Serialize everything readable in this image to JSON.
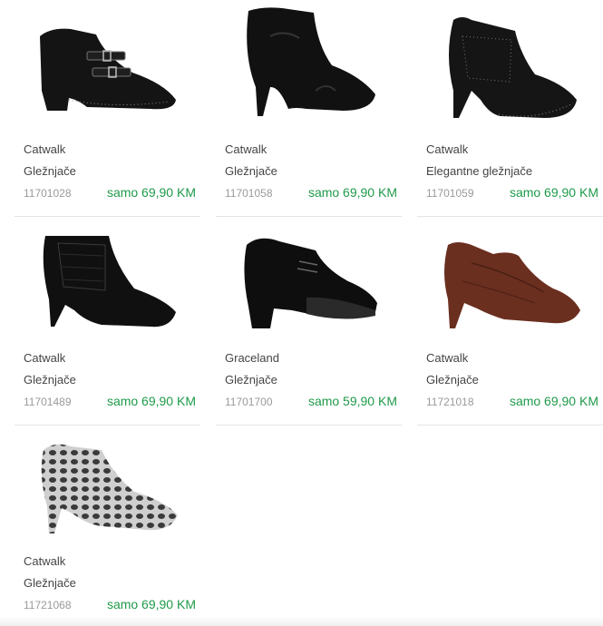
{
  "products": [
    {
      "brand": "Catwalk",
      "category": "Gležnjače",
      "sku": "11701028",
      "price": "samo 69,90 KM",
      "image": "black-studded-buckle-ankle-boot"
    },
    {
      "brand": "Catwalk",
      "category": "Gležnjače",
      "sku": "11701058",
      "price": "samo 69,90 KM",
      "image": "black-suede-western-ankle-boot"
    },
    {
      "brand": "Catwalk",
      "category": "Elegantne gležnjače",
      "sku": "11701059",
      "price": "samo 69,90 KM",
      "image": "black-studded-stiletto-bootie"
    },
    {
      "brand": "Catwalk",
      "category": "Gležnjače",
      "sku": "11701489",
      "price": "samo 69,90 KM",
      "image": "black-croc-stiletto-bootie"
    },
    {
      "brand": "Graceland",
      "category": "Gležnjače",
      "sku": "11701700",
      "price": "samo 59,90 KM",
      "image": "black-lace-up-block-heel-shoe"
    },
    {
      "brand": "Catwalk",
      "category": "Gležnjače",
      "sku": "11721018",
      "price": "samo 69,90 KM",
      "image": "brown-croc-stiletto-bootie"
    },
    {
      "brand": "Catwalk",
      "category": "Gležnjače",
      "sku": "11721068",
      "price": "samo 69,90 KM",
      "image": "snake-print-stiletto-bootie"
    }
  ],
  "colors": {
    "price": "#1f9a4a",
    "sku": "#9a9a9a",
    "text": "#444444",
    "divider": "#e4e4e4"
  }
}
